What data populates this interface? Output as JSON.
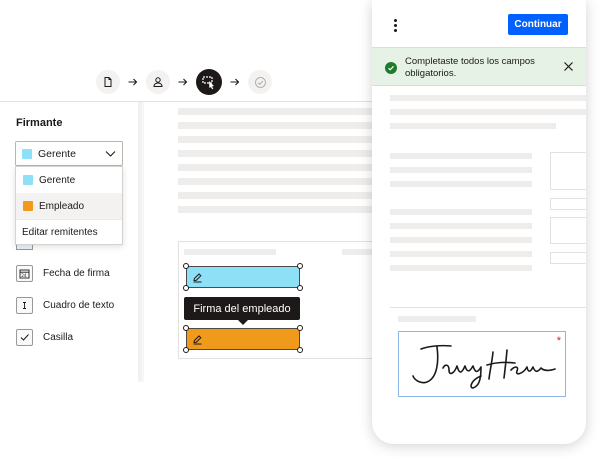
{
  "stepper": {
    "steps": [
      {
        "icon": "document-icon",
        "state": "done"
      },
      {
        "icon": "person-icon",
        "state": "done"
      },
      {
        "icon": "cursor-select-icon",
        "state": "active"
      },
      {
        "icon": "check-circle-icon",
        "state": "future"
      }
    ]
  },
  "left_panel": {
    "signer_label": "Firmante",
    "selected_signer": "Gerente",
    "dropdown": {
      "options": [
        {
          "label": "Gerente",
          "color": "#8ee0f6"
        },
        {
          "label": "Empleado",
          "color": "#f09a1b"
        }
      ],
      "edit_label": "Editar remitentes"
    },
    "tools": [
      {
        "label": "Fecha de firma",
        "icon": "calendar-icon"
      },
      {
        "label": "Cuadro de texto",
        "icon": "text-box-icon"
      },
      {
        "label": "Casilla",
        "icon": "checkbox-icon"
      }
    ]
  },
  "document": {
    "tooltip": "Firma del empleado",
    "fields": [
      {
        "role": "Gerente",
        "color": "#8ee0f6"
      },
      {
        "role": "Empleado",
        "color": "#f09a1b"
      }
    ]
  },
  "phone": {
    "continue_label": "Continuar",
    "toast_message": "Completaste todos los campos obligatorios.",
    "signature_text": "Jenny Hernández"
  },
  "colors": {
    "accent": "#0061fe",
    "success": "#1f7a2c",
    "manager": "#8ee0f6",
    "employee": "#f09a1b"
  }
}
